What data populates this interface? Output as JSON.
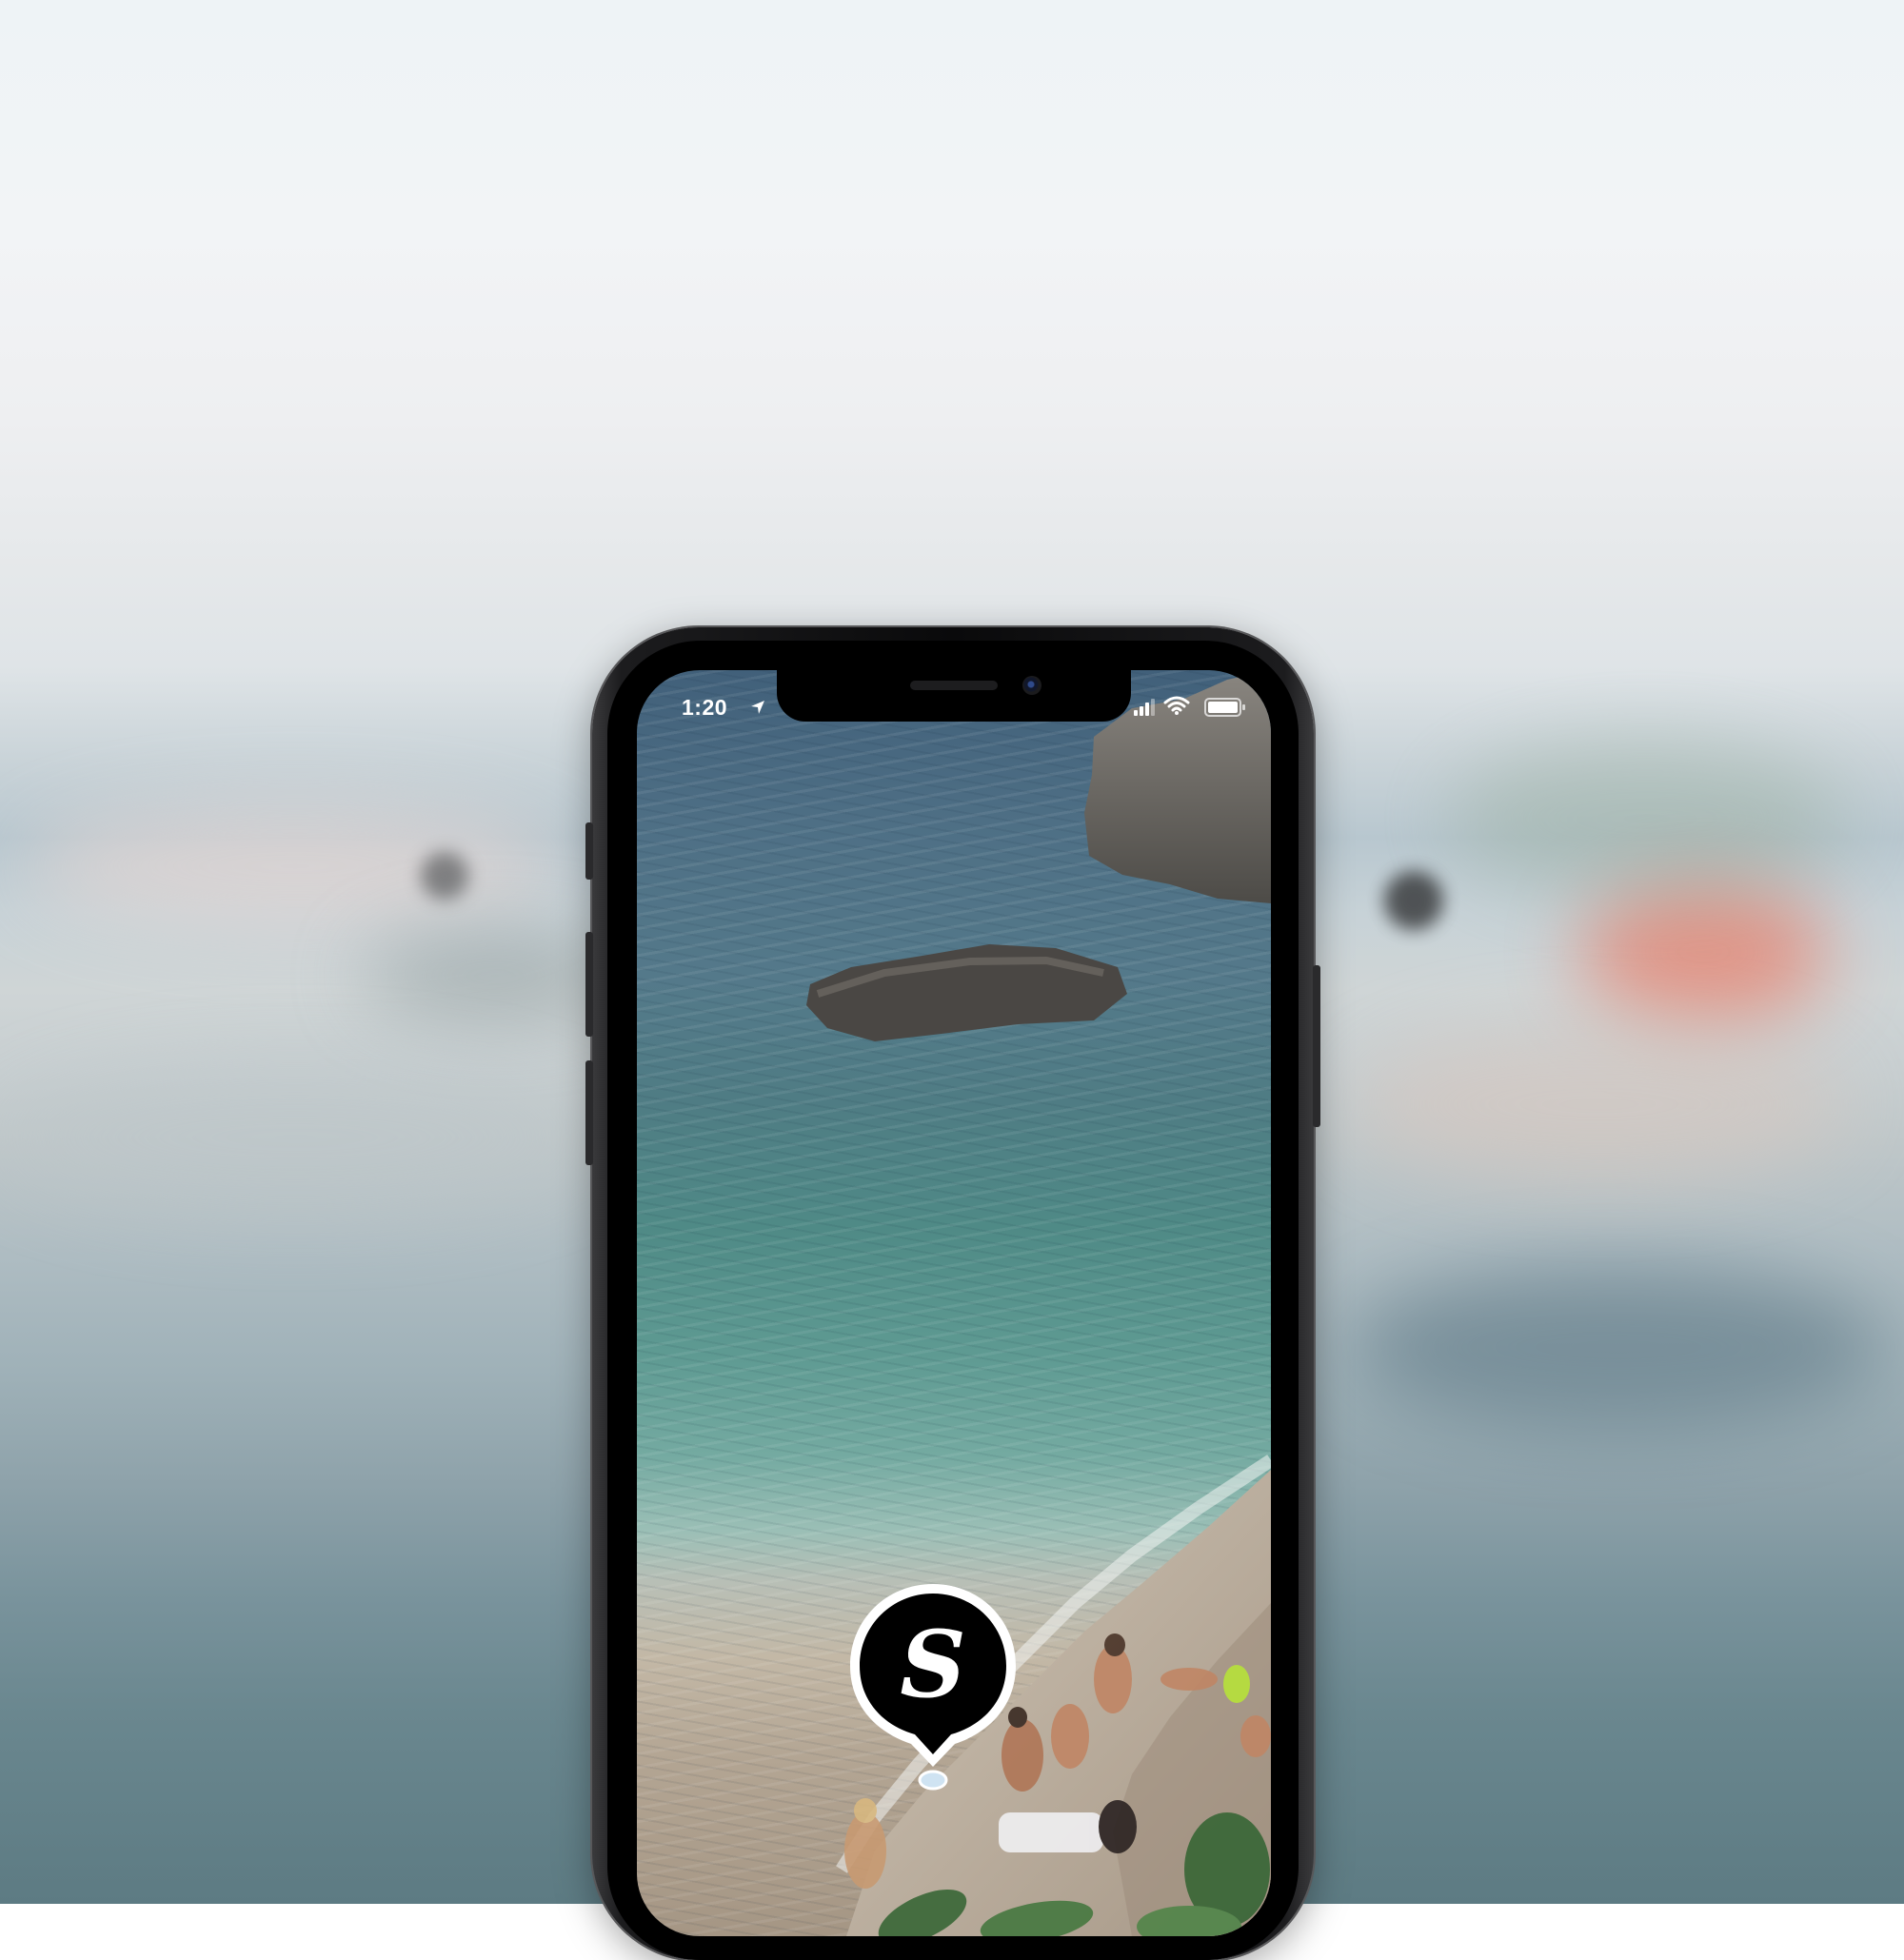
{
  "status_bar": {
    "time": "1:20",
    "location_icon": "location-arrow-icon",
    "signal_icon": "cellular-signal-icon",
    "wifi_icon": "wifi-icon",
    "battery_icon": "battery-icon"
  },
  "map_pin": {
    "letter": "S",
    "icon": "map-pin-icon"
  },
  "colors": {
    "pin_fill": "#000000",
    "pin_border": "#ffffff",
    "status_text": "#ffffff"
  }
}
